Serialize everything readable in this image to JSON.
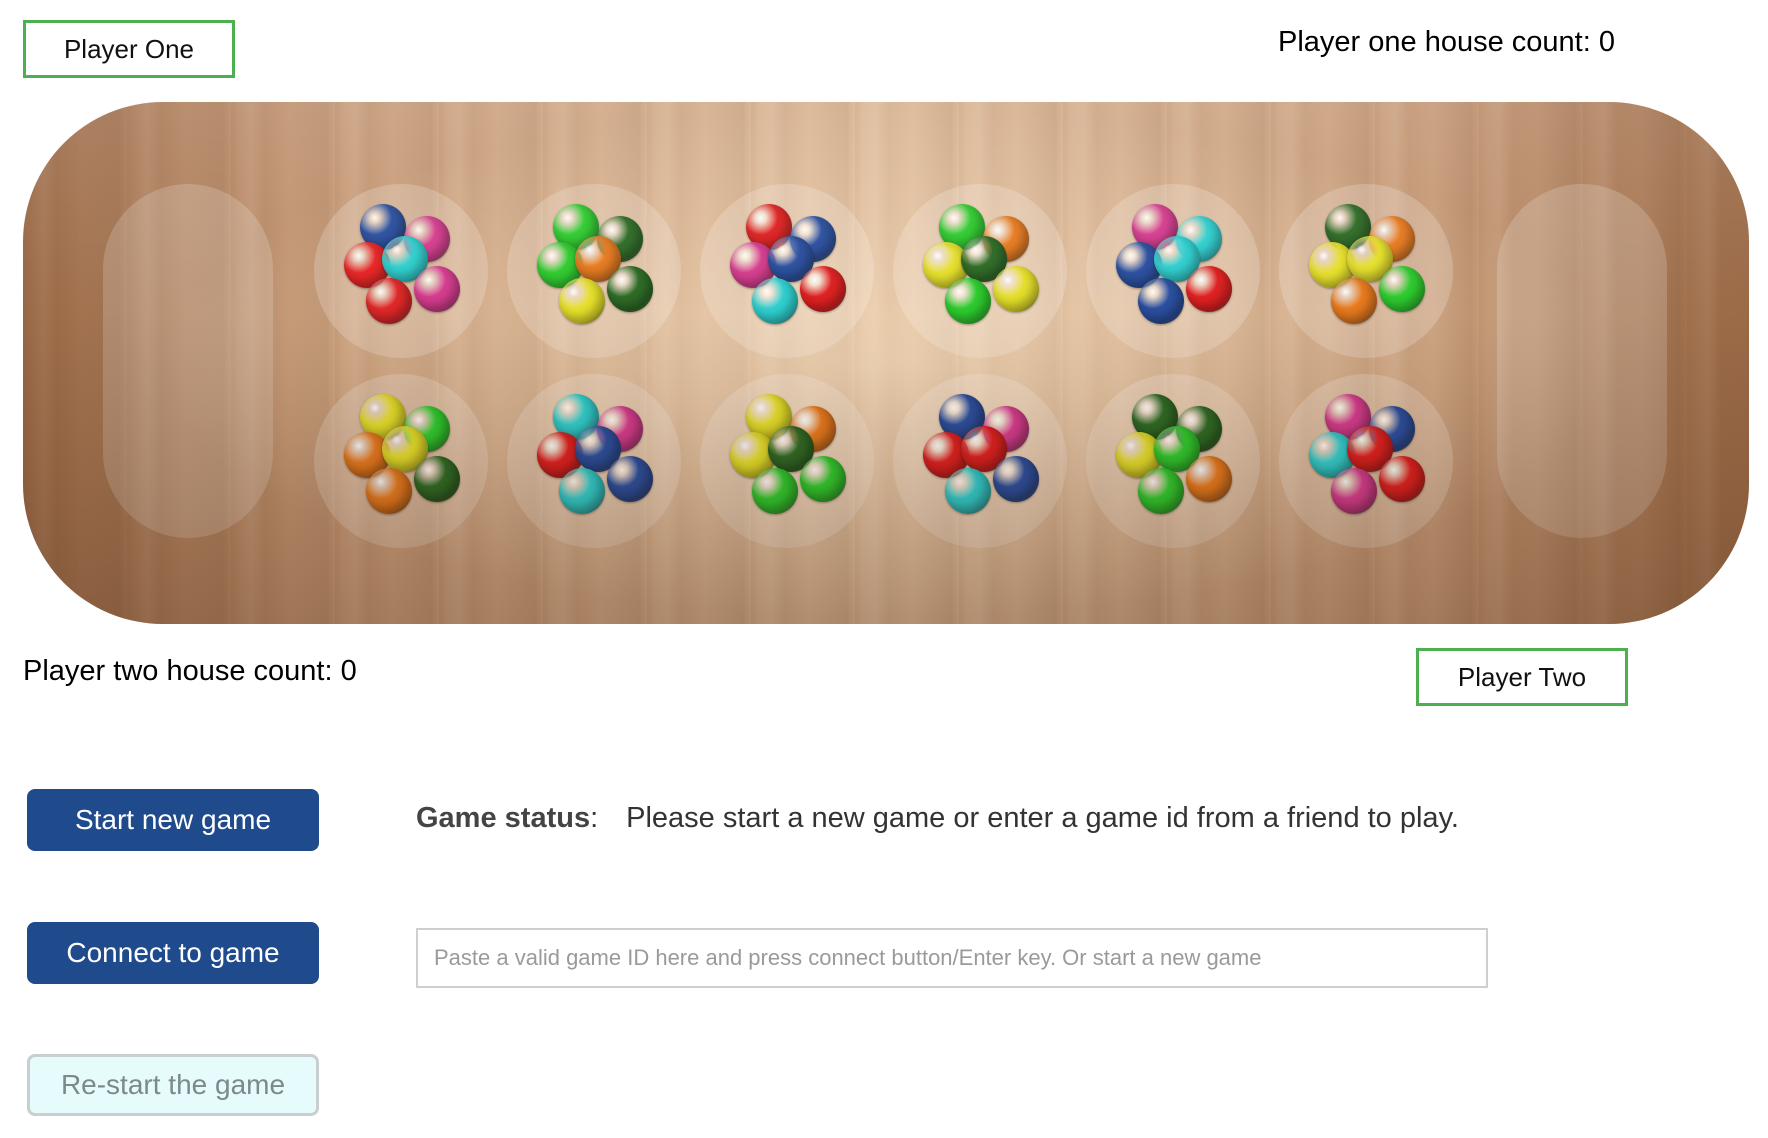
{
  "players": {
    "one": {
      "label": "Player One",
      "house_count_text": "Player one house count: 0",
      "house_count": 0
    },
    "two": {
      "label": "Player Two",
      "house_count_text": "Player two house count: 0",
      "house_count": 0
    }
  },
  "board": {
    "stores": {
      "left_seeds": 0,
      "right_seeds": 0
    },
    "top_row": [
      {
        "seeds": [
          "#2a4fa0",
          "#d63c8f",
          "#e82323",
          "#2fd0d0",
          "#e02828",
          "#d63c8f"
        ]
      },
      {
        "seeds": [
          "#2ecc2e",
          "#2d6b25",
          "#2ecc2e",
          "#e87a1e",
          "#e6e02a",
          "#2d6b25"
        ]
      },
      {
        "seeds": [
          "#e02020",
          "#2a4fa0",
          "#d63c8f",
          "#2a4fa0",
          "#2fd0d0",
          "#e02020"
        ]
      },
      {
        "seeds": [
          "#2ecc2e",
          "#e87a1e",
          "#e6e02a",
          "#2d6b25",
          "#2ecc2e",
          "#e6e02a"
        ]
      },
      {
        "seeds": [
          "#d63c8f",
          "#2fd0d0",
          "#2a4fa0",
          "#2fd0d0",
          "#2a4fa0",
          "#e02020"
        ]
      },
      {
        "seeds": [
          "#2d6b25",
          "#e87a1e",
          "#e6e02a",
          "#e6e02a",
          "#e87a1e",
          "#2ecc2e"
        ]
      }
    ],
    "bottom_row": [
      {
        "seeds": [
          "#e6e02a",
          "#2ecc2e",
          "#e87a1e",
          "#e6e02a",
          "#e87a1e",
          "#2d6b25"
        ]
      },
      {
        "seeds": [
          "#2fd0d0",
          "#d63c8f",
          "#e02020",
          "#2a4fa0",
          "#2fd0d0",
          "#2a4fa0"
        ]
      },
      {
        "seeds": [
          "#e6e02a",
          "#e87a1e",
          "#e6e02a",
          "#2d6b25",
          "#2ecc2e",
          "#2ecc2e"
        ]
      },
      {
        "seeds": [
          "#2a4fa0",
          "#d63c8f",
          "#e02020",
          "#e02020",
          "#2fd0d0",
          "#2a4fa0"
        ]
      },
      {
        "seeds": [
          "#2d6b25",
          "#2d6b25",
          "#e6e02a",
          "#2ecc2e",
          "#2ecc2e",
          "#e87a1e"
        ]
      },
      {
        "seeds": [
          "#d63c8f",
          "#2a4fa0",
          "#2fd0d0",
          "#e02020",
          "#d63c8f",
          "#e02020"
        ]
      }
    ]
  },
  "controls": {
    "start_label": "Start new game",
    "connect_label": "Connect to game",
    "restart_label": "Re-start the game"
  },
  "status": {
    "label": "Game status",
    "message": "Please start a new game or enter a game id from a friend to play."
  },
  "game_id_input": {
    "placeholder": "Paste a valid game ID here and press connect button/Enter key. Or start a new game",
    "value": ""
  },
  "colors": {
    "accent_green": "#4caf50",
    "primary_button": "#1f4a8c",
    "restart_button_bg": "#e6fbfb"
  }
}
